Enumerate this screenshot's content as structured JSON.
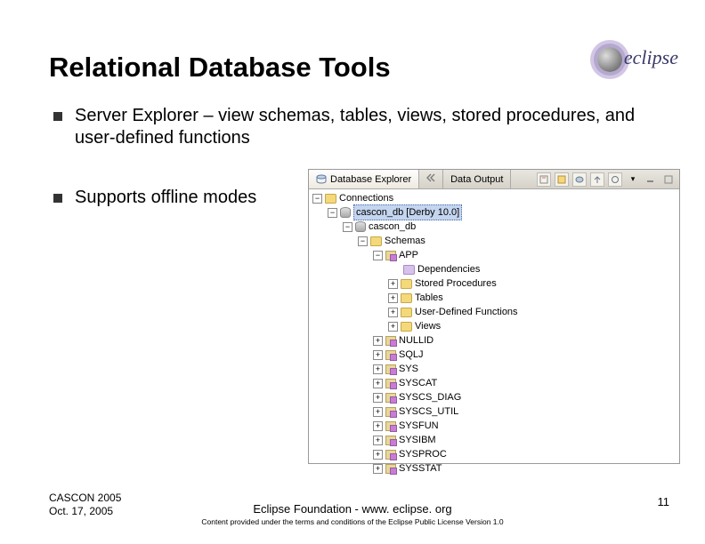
{
  "title": "Relational Database Tools",
  "logo_text": "eclipse",
  "bullets": {
    "b1": "Server Explorer – view schemas, tables, views, stored procedures, and user-defined functions",
    "b2": "Supports offline modes"
  },
  "explorer": {
    "tabs": {
      "db_explorer": "Database Explorer",
      "data_output": "Data Output"
    },
    "tree": {
      "connections": "Connections",
      "db_conn": "cascon_db [Derby 10.0]",
      "db": "cascon_db",
      "schemas": "Schemas",
      "app": "APP",
      "dependencies": "Dependencies",
      "stored_procs": "Stored Procedures",
      "tables": "Tables",
      "udf": "User-Defined Functions",
      "views": "Views",
      "s_nullid": "NULLID",
      "s_sqlj": "SQLJ",
      "s_sys": "SYS",
      "s_syscat": "SYSCAT",
      "s_syscs_diag": "SYSCS_DIAG",
      "s_syscs_util": "SYSCS_UTIL",
      "s_sysfun": "SYSFUN",
      "s_sysibm": "SYSIBM",
      "s_sysproc": "SYSPROC",
      "s_sysstat": "SYSSTAT"
    }
  },
  "footer": {
    "event": "CASCON 2005",
    "date": "Oct. 17, 2005",
    "org": "Eclipse Foundation - www. eclipse. org",
    "license": "Content provided under the terms and conditions of the Eclipse Public License Version 1.0",
    "page": "11"
  }
}
